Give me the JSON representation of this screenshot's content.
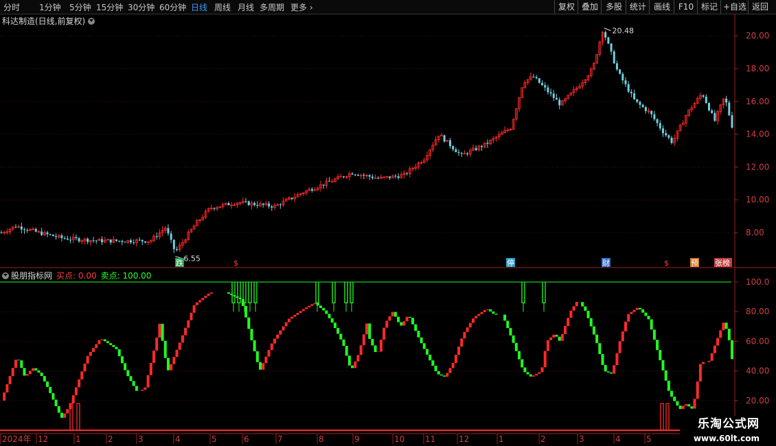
{
  "toolbar": {
    "periods": [
      "分时",
      "1分钟",
      "5分钟",
      "15分钟",
      "30分钟",
      "60分钟",
      "日线",
      "周线",
      "月线",
      "多周期",
      "更多"
    ],
    "active_period": "日线",
    "right_buttons": [
      "复权",
      "叠加",
      "多股",
      "统计",
      "画线",
      "F10",
      "+自选",
      "返回"
    ]
  },
  "main_chart": {
    "title": "科达制造(日线,前复权)",
    "price_ticks": [
      "20.00",
      "18.00",
      "16.00",
      "14.00",
      "12.00",
      "10.00",
      "8.00"
    ],
    "high_label": "20.48",
    "low_label": "6.55",
    "event_markers": [
      {
        "text": "跌",
        "color": "#1f9e4a"
      },
      {
        "text": "$",
        "color": "#ff3b3b"
      },
      {
        "text": "停",
        "color": "#2aa0c8"
      },
      {
        "text": "财",
        "color": "#3a6fd0"
      },
      {
        "text": "$",
        "color": "#ff3b3b"
      },
      {
        "text": "预",
        "color": "#d07a20"
      },
      {
        "text": "张榜",
        "color": "#c04040"
      }
    ]
  },
  "indicator": {
    "name": "股朋指标网",
    "buy_label": "买点: 0.00",
    "sell_label": "卖点: 100.00",
    "ticks": [
      "100.0",
      "80.00",
      "60.00",
      "40.00",
      "20.00"
    ]
  },
  "time_axis": {
    "labels": [
      "2024年",
      "12",
      "1",
      "2",
      "3",
      "4",
      "5",
      "6",
      "7",
      "8",
      "9",
      "10",
      "11",
      "12",
      "1",
      "2",
      "3",
      "4",
      "5",
      "6"
    ]
  },
  "watermark": {
    "line1": "乐淘公式网",
    "line2": "www.60lt.com"
  },
  "colors": {
    "up": "#ff2a2a",
    "down": "#20ff20",
    "cyan": "#6fd0e0",
    "grid": "#5a1010",
    "axis": "#a02020",
    "active": "#3a9bff"
  }
}
